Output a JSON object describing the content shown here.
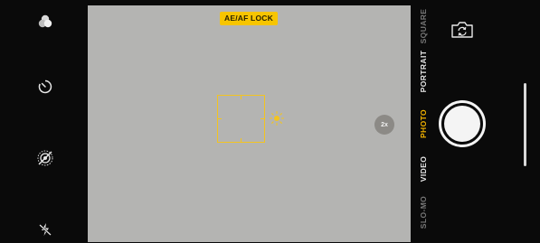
{
  "viewfinder": {
    "lock_badge": "AE/AF LOCK",
    "zoom_label": "2x"
  },
  "left_controls": [
    {
      "name": "filters-icon"
    },
    {
      "name": "timer-icon"
    },
    {
      "name": "live-photo-off-icon"
    },
    {
      "name": "flash-off-icon"
    }
  ],
  "modes": {
    "items": [
      "SQUARE",
      "PORTRAIT",
      "PHOTO",
      "VIDEO",
      "SLO-MO"
    ],
    "selected": "PHOTO"
  },
  "colors": {
    "accent": "#f4b400",
    "badge": "#f7c500",
    "viewfinder": "#b4b4b2",
    "background": "#0a0a0a"
  }
}
